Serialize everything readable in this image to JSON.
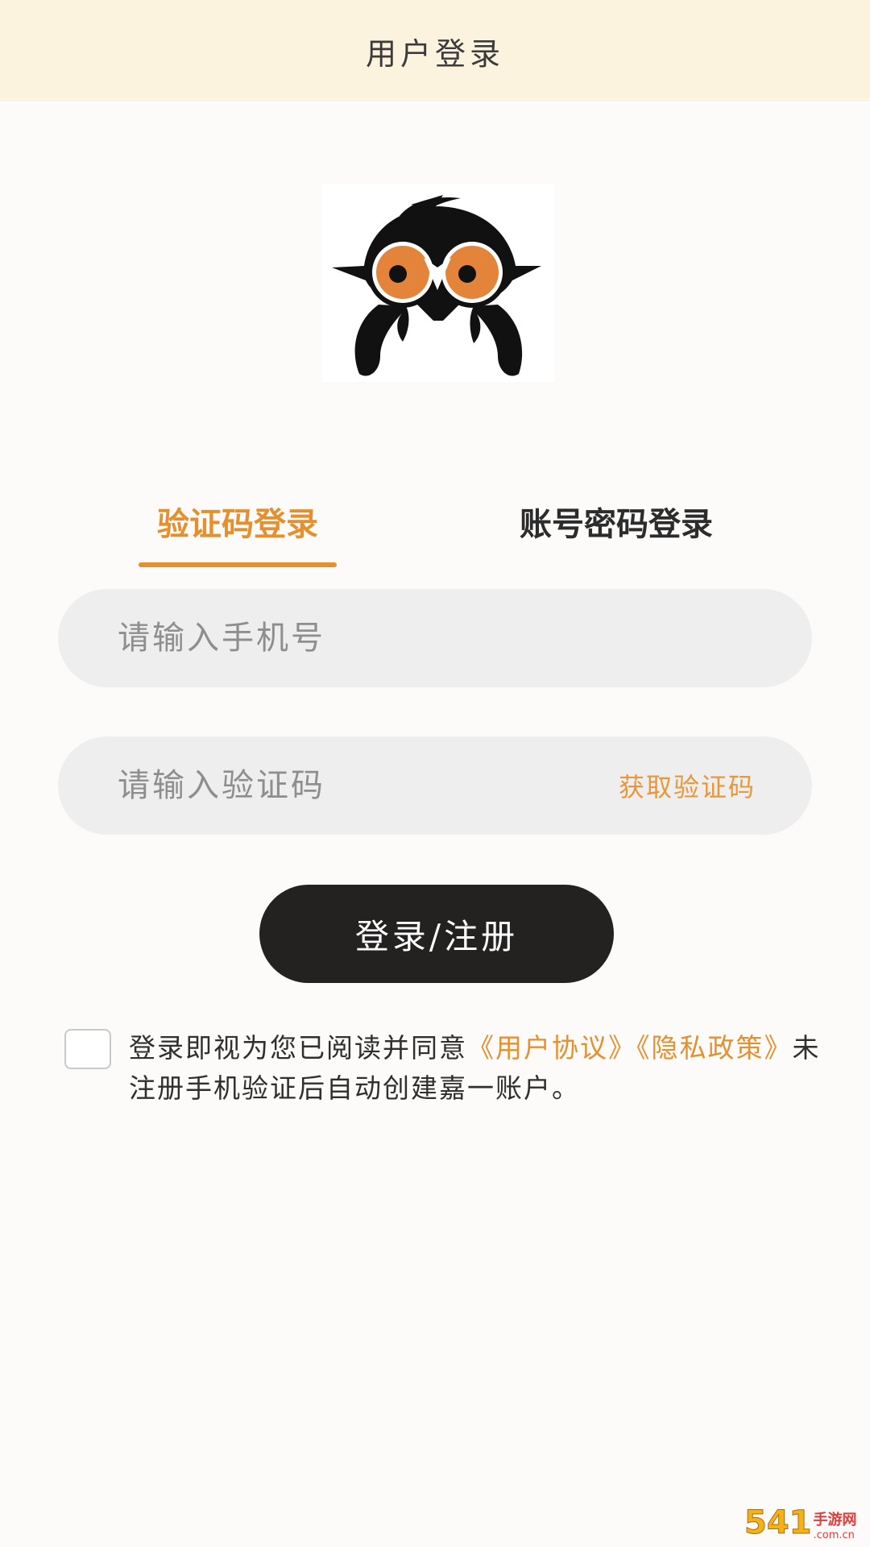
{
  "header": {
    "title": "用户登录"
  },
  "tabs": [
    {
      "label": "验证码登录",
      "active": true
    },
    {
      "label": "账号密码登录",
      "active": false
    }
  ],
  "form": {
    "phone_placeholder": "请输入手机号",
    "code_placeholder": "请输入验证码",
    "get_code_label": "获取验证码",
    "submit_label": "登录/注册"
  },
  "agreement": {
    "checked": false,
    "prefix": "登录即视为您已阅读并同意",
    "user_agreement": "《用户协议》",
    "privacy_policy": "《隐私政策》",
    "suffix": "未注册手机验证后自动创建嘉一账户。"
  },
  "watermark": {
    "number": "541",
    "brand": "手游网",
    "domain": ".com.cn"
  },
  "colors": {
    "accent": "#e5902f",
    "header_bg": "#fcf3df",
    "button_bg": "#242121",
    "field_bg": "#eeeeee",
    "owl_eye": "#e3843a"
  },
  "icons": {
    "logo": "owl-logo-icon"
  }
}
